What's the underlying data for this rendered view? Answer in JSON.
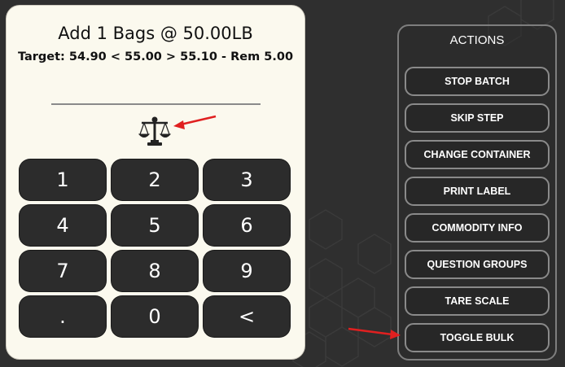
{
  "header": {
    "title": "Add 1 Bags @ 50.00LB",
    "target": "Target: 54.90 < 55.00 > 55.10 - Rem 5.00"
  },
  "weight_input": {
    "value": ""
  },
  "icons": {
    "scale": "scale-icon"
  },
  "keypad": {
    "keys": [
      "1",
      "2",
      "3",
      "4",
      "5",
      "6",
      "7",
      "8",
      "9",
      ".",
      "0",
      "<"
    ]
  },
  "actions": {
    "title": "ACTIONS",
    "buttons": [
      "STOP BATCH",
      "SKIP STEP",
      "CHANGE CONTAINER",
      "PRINT LABEL",
      "COMMODITY INFO",
      "QUESTION GROUPS",
      "TARE SCALE",
      "TOGGLE BULK"
    ]
  },
  "colors": {
    "background": "#2f2f2f",
    "panel": "#fbf9ee",
    "key": "#2c2c2c",
    "annotation_arrow": "#e02020"
  }
}
